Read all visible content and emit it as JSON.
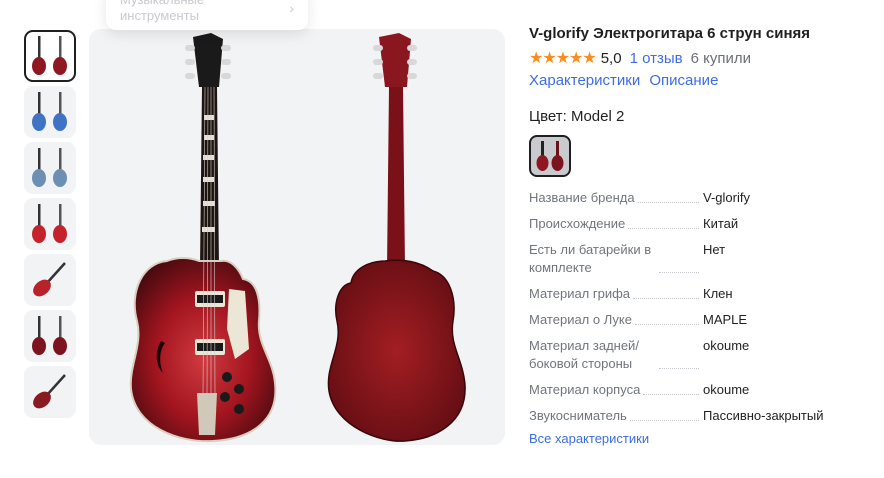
{
  "category_popup": {
    "text": "Музыкальные инструменты",
    "chevron": "chevron-right-icon"
  },
  "thumbnails": [
    {
      "name": "thumb-red-pair",
      "body": "#8f1722",
      "active": true
    },
    {
      "name": "thumb-blue-pair",
      "body": "#3f73c4",
      "active": false
    },
    {
      "name": "thumb-bluegrey-pair",
      "body": "#6d8fb4",
      "active": false
    },
    {
      "name": "thumb-red-strat-pair",
      "body": "#c4232c",
      "active": false
    },
    {
      "name": "thumb-red-diagonal",
      "body": "#b8232b",
      "active": false
    },
    {
      "name": "thumb-darkred-pair",
      "body": "#7c1420",
      "active": false
    },
    {
      "name": "thumb-lespaul-diagonal",
      "body": "#8a1a22",
      "active": false
    }
  ],
  "product": {
    "title": "V-glorify Электрогитара 6 струн синяя",
    "stars": "★★★★★",
    "rating": "5,0",
    "reviews": "1 отзыв",
    "bought": "6 купили",
    "link_specs": "Характеристики",
    "link_desc": "Описание",
    "color_label": "Цвет: Model 2"
  },
  "specs": [
    {
      "name": "Название бренда",
      "value": "V-glorify"
    },
    {
      "name": "Происхождение",
      "value": "Китай"
    },
    {
      "name": "Есть ли батарейки в комплекте",
      "value": "Нет"
    },
    {
      "name": "Материал грифа",
      "value": "Клен"
    },
    {
      "name": "Материал о Луке",
      "value": "MAPLE"
    },
    {
      "name": "Материал задней/боковой стороны",
      "value": "okoume"
    },
    {
      "name": "Материал корпуса",
      "value": "okoume"
    },
    {
      "name": "Звукосниматель",
      "value": "Пассивно-закрытый"
    }
  ],
  "all_specs_link": "Все характеристики",
  "colors": {
    "accent": "#3d6ce7",
    "star": "#ff8c1a",
    "guitar_body": "#8f1722",
    "image_bg": "#f2f3f5"
  }
}
